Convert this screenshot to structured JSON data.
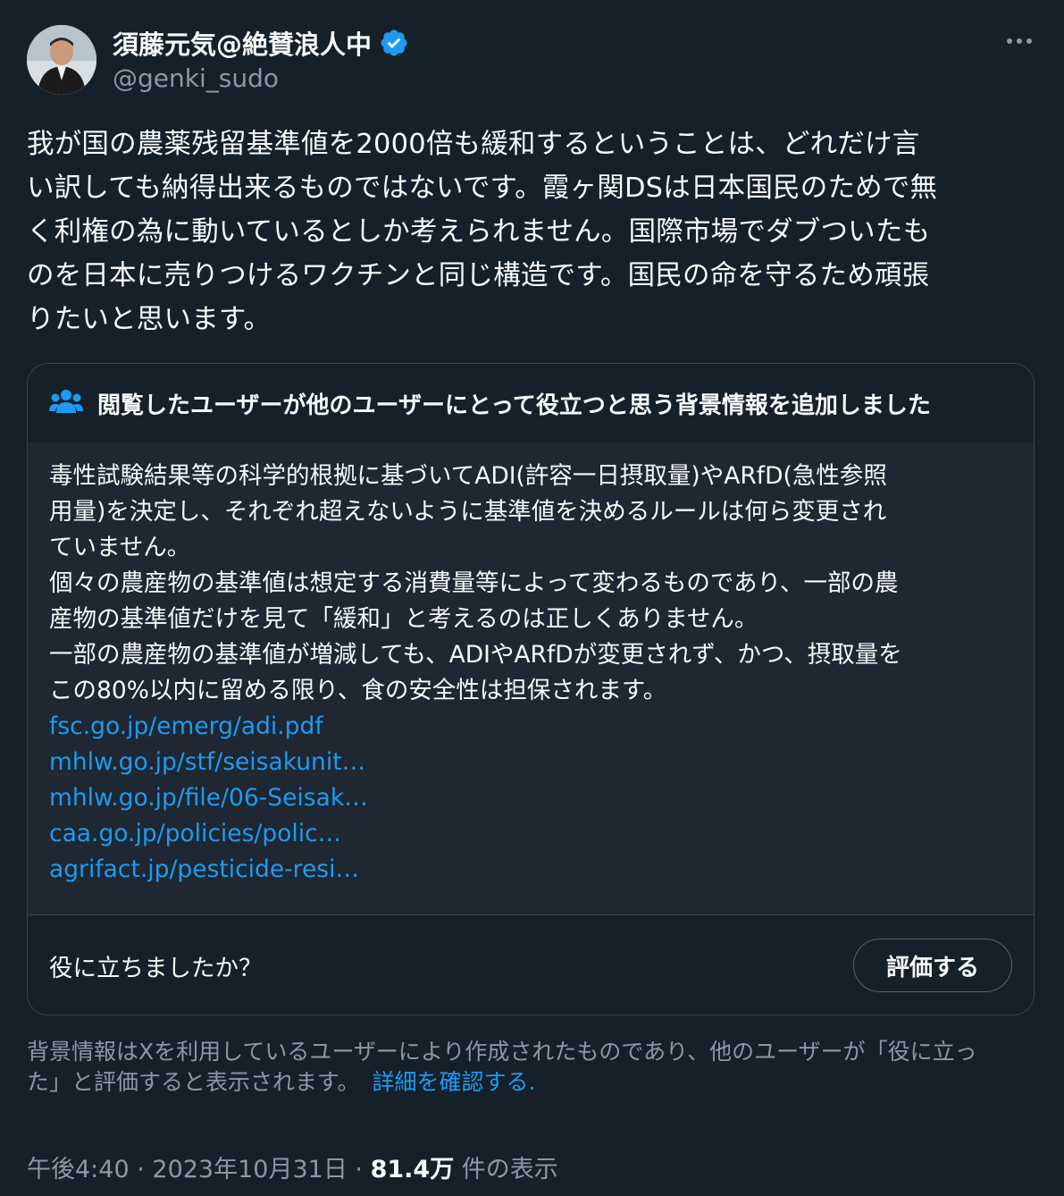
{
  "user": {
    "display_name": "須藤元気@絶賛浪人中",
    "handle": "@genki_sudo"
  },
  "tweet": {
    "text": "我が国の農薬残留基準値を2000倍も緩和するということは、どれだけ言\nい訳しても納得出来るものではないです。霞ヶ関DSは日本国民のためで無\nく利権の為に動いているとしか考えられません。国際市場でダブついたも\nのを日本に売りつけるワクチンと同じ構造です。国民の命を守るため頑張\nりたいと思います。"
  },
  "community_note": {
    "header": "閲覧したユーザーが他のユーザーにとって役立つと思う背景情報を追加しました",
    "body": "毒性試験結果等の科学的根拠に基づいてADI(許容一日摂取量)やARfD(急性参照\n用量)を決定し、それぞれ超えないように基準値を決めるルールは何ら変更され\nていません。\n個々の農産物の基準値は想定する消費量等によって変わるものであり、一部の農\n産物の基準値だけを見て「緩和」と考えるのは正しくありません。\n一部の農産物の基準値が増減しても、ADIやARfDが変更されず、かつ、摂取量を\nこの80%以内に留める限り、食の安全性は担保されます。",
    "links": [
      "fsc.go.jp/emerg/adi.pdf",
      "mhlw.go.jp/stf/seisakunit…",
      "mhlw.go.jp/file/06-Seisak…",
      "caa.go.jp/policies/polic…",
      "agrifact.jp/pesticide-resi…"
    ],
    "helpful_question": "役に立ちましたか？",
    "rate_button": "評価する"
  },
  "disclaimer": {
    "text": "背景情報はXを利用しているユーザーにより作成されたものであり、他のユーザーが「役に立っ\nた」と評価すると表示されます。",
    "link": "詳細を確認する."
  },
  "meta": {
    "time": "午後4:40",
    "separator": " · ",
    "date": "2023年10月31日",
    "views_count": "81.4万",
    "views_label": " 件の表示"
  },
  "icons": {
    "verified": "verified-badge-icon",
    "more": "more-options-icon",
    "community": "community-people-icon"
  },
  "colors": {
    "background": "#15202b",
    "link": "#1d9bf0",
    "muted": "#8b98a5",
    "note_body_bg": "#1e2732"
  }
}
